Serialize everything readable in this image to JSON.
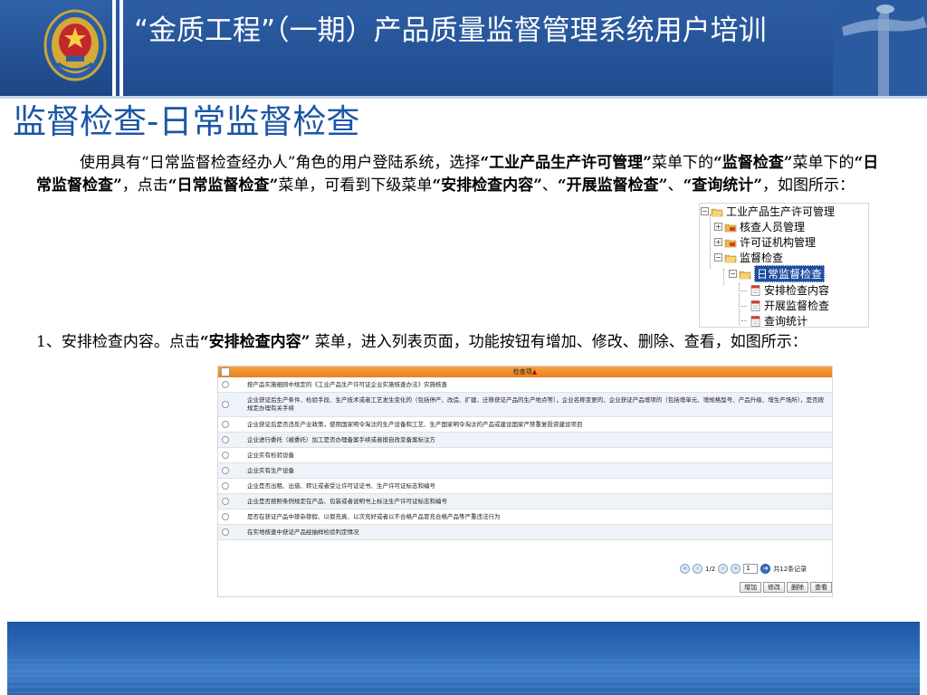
{
  "header": {
    "title": "“金质工程”（一期）产品质量监督管理系统用户培训"
  },
  "slide_title": "监督检查-日常监督检查",
  "intro": {
    "t1": "使用具有“日常监督检查经办人”角色的用户登陆系统，选择",
    "b1": "“工业产品生产许可管理”",
    "t2": "菜单下的",
    "b2": "“监督检查”",
    "t3": "菜单下的",
    "b3": "“日常监督检查”",
    "t4": "，点击",
    "b4": "“日常监督检查”",
    "t5": "菜单，可看到下级菜单",
    "b5": "“安排检查内容”",
    "t6": "、",
    "b6": "“开展监督检查”",
    "t7": "、",
    "b7": "“查询统计”",
    "t8": "，如图所示："
  },
  "tree": {
    "root": "工业产品生产许可管理",
    "items": [
      "核查人员管理",
      "许可证机构管理",
      "监督检查"
    ],
    "selected": "日常监督检查",
    "children": [
      "安排检查内容",
      "开展监督检查",
      "查询统计"
    ]
  },
  "step1": {
    "t1": "1、安排检查内容。点击",
    "b1": "“安排检查内容”",
    "t2": " 菜单，进入列表页面，功能按钮有增加、修改、删除、查看，如图所示："
  },
  "table": {
    "header": "检查项",
    "sort_marker": "▲",
    "rows": [
      "按产品实施细则中规定的《工业产品生产许可证企业实施核查办法》实施核查",
      "企业获证后生产条件、检验手段、生产技术或者工艺发生变化的（包括停产、改造、扩建、迁移获证产品的生产地点等），企业名称变更的、企业获证产品增项的（包括增单元、增规格型号、产品升级、增生产场所），是否按规定办理有关手续",
      "企业获证后是否违反产业政策，使用国家明令淘汰的生产设备和工艺、生产国家明令淘汰的产品或建设国家严禁重复投资建设项目",
      "企业进行委托（被委托）加工是否办理备案手续或者擅自改变备案标注方",
      "企业实有检验设备",
      "企业实有生产设备",
      "企业是否出租、出借、转让或者受让许可证证书、生产许可证标志和编号",
      "企业是否按照条例规定在产品、包装或者说明书上标注生产许可证标志和编号",
      "是否在获证产品中掺杂掺假、以假充真、以次充好或者以不合格产品冒充合格产品等严重违法行为",
      "在实地核查中获证产品经抽样检验判定情况"
    ],
    "pager": {
      "page": "1/2",
      "input": "1",
      "total": "共12条记录"
    },
    "buttons": [
      "增加",
      "修改",
      "删除",
      "查看"
    ]
  },
  "colors": {
    "header_bg": "#2d5da3",
    "title_blue": "#1c56a6",
    "table_header": "#f29a35"
  }
}
